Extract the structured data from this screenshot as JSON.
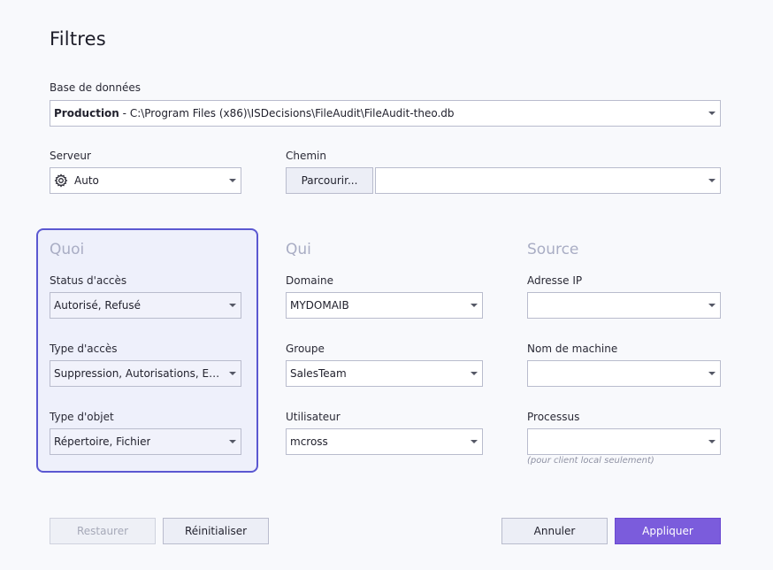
{
  "title": "Filtres",
  "database": {
    "label": "Base de données",
    "name": "Production",
    "separator": " - ",
    "path": "C:\\Program Files (x86)\\ISDecisions\\FileAudit\\FileAudit-theo.db"
  },
  "server": {
    "label": "Serveur",
    "value": "Auto",
    "icon": "gear-icon"
  },
  "path_field": {
    "label": "Chemin",
    "browse_label": "Parcourir...",
    "value": ""
  },
  "quoi": {
    "title": "Quoi",
    "access_status": {
      "label": "Status d'accès",
      "value": "Autorisé, Refusé"
    },
    "access_type": {
      "label": "Type d'accès",
      "value": "Suppression, Autorisations, Ecri..."
    },
    "object_type": {
      "label": "Type d'objet",
      "value": "Répertoire, Fichier"
    }
  },
  "qui": {
    "title": "Qui",
    "domain": {
      "label": "Domaine",
      "value": "MYDOMAIB"
    },
    "group": {
      "label": "Groupe",
      "value": "SalesTeam"
    },
    "user": {
      "label": "Utilisateur",
      "value": "mcross"
    }
  },
  "source": {
    "title": "Source",
    "ip": {
      "label": "Adresse IP",
      "value": ""
    },
    "machine": {
      "label": "Nom de machine",
      "value": ""
    },
    "process": {
      "label": "Processus",
      "value": "",
      "note": "(pour client local seulement)"
    }
  },
  "buttons": {
    "restore": "Restaurer",
    "reset": "Réinitialiser",
    "cancel": "Annuler",
    "apply": "Appliquer"
  },
  "colors": {
    "accent": "#7b5cdc",
    "focus_border": "#5b58d1",
    "section_title": "#a9adc4"
  }
}
